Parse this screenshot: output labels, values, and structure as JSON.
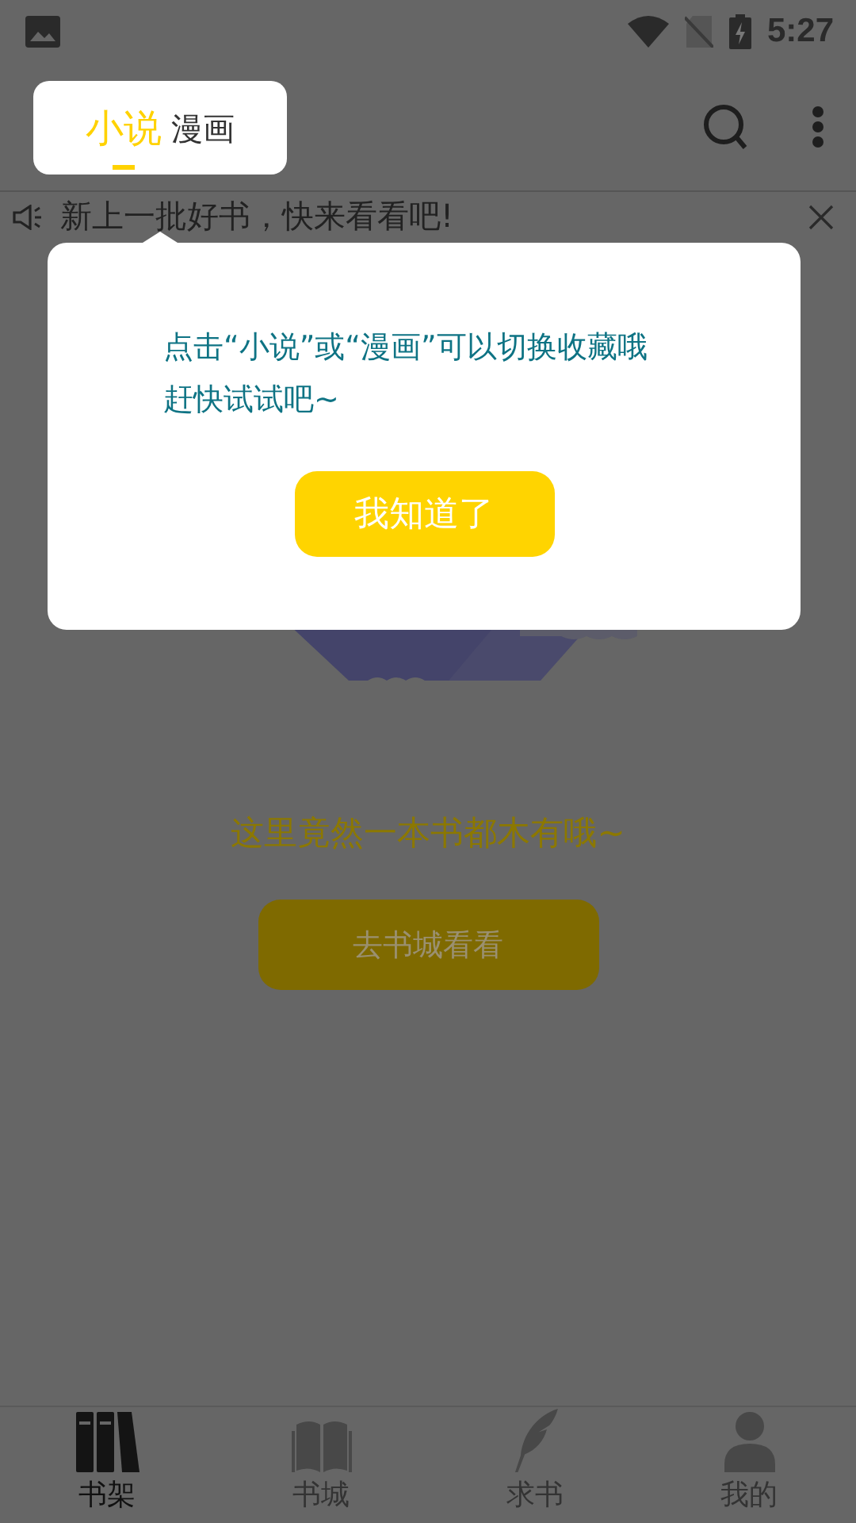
{
  "status_bar": {
    "time": "5:27"
  },
  "header": {
    "tabs": [
      {
        "label": "小说",
        "selected": true
      },
      {
        "label": "漫画",
        "selected": false
      }
    ]
  },
  "notice": {
    "text": "新上一批好书，快来看看吧!"
  },
  "empty_state": {
    "message": "这里竟然一本书都木有哦~",
    "button": "去书城看看"
  },
  "tip_dialog": {
    "lines": [
      "点击“小说”或“漫画”可以切换收藏哦",
      "赶快试试吧~"
    ],
    "button": "我知道了"
  },
  "bottom_nav": [
    {
      "label": "书架",
      "kind": "shelf",
      "selected": true
    },
    {
      "label": "书城",
      "kind": "book",
      "selected": false
    },
    {
      "label": "求书",
      "kind": "feather",
      "selected": false
    },
    {
      "label": "我的",
      "kind": "person",
      "selected": false
    }
  ]
}
